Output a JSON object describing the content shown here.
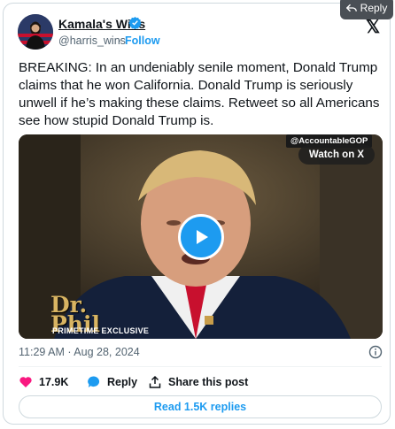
{
  "overlay": {
    "reply_label": "Reply"
  },
  "author": {
    "display_name": "Kamala's Wins",
    "handle": "@harris_wins",
    "separator": "·",
    "follow_label": "Follow"
  },
  "tweet": {
    "text": "BREAKING: In an undeniably senile moment, Donald Trump claims that he won California. Donald Trump is seriously unwell if he’s making these claims. Retweet so all Americans see how stupid Donald Trump is."
  },
  "media": {
    "watermark": "@AccountableGOP",
    "watch_label": "Watch on X",
    "logo_line1": "Dr.",
    "logo_line2": "Phil",
    "logo_sub": "PRIMETIME EXCLUSIVE"
  },
  "meta": {
    "timestamp": "11:29 AM · Aug 28, 2024"
  },
  "actions": {
    "likes": "17.9K",
    "reply_label": "Reply",
    "share_label": "Share this post"
  },
  "footer": {
    "read_replies_label": "Read 1.5K replies"
  },
  "colors": {
    "accent": "#1d9bf0",
    "like": "#f91880",
    "text": "#0f1419",
    "muted": "#536471"
  }
}
